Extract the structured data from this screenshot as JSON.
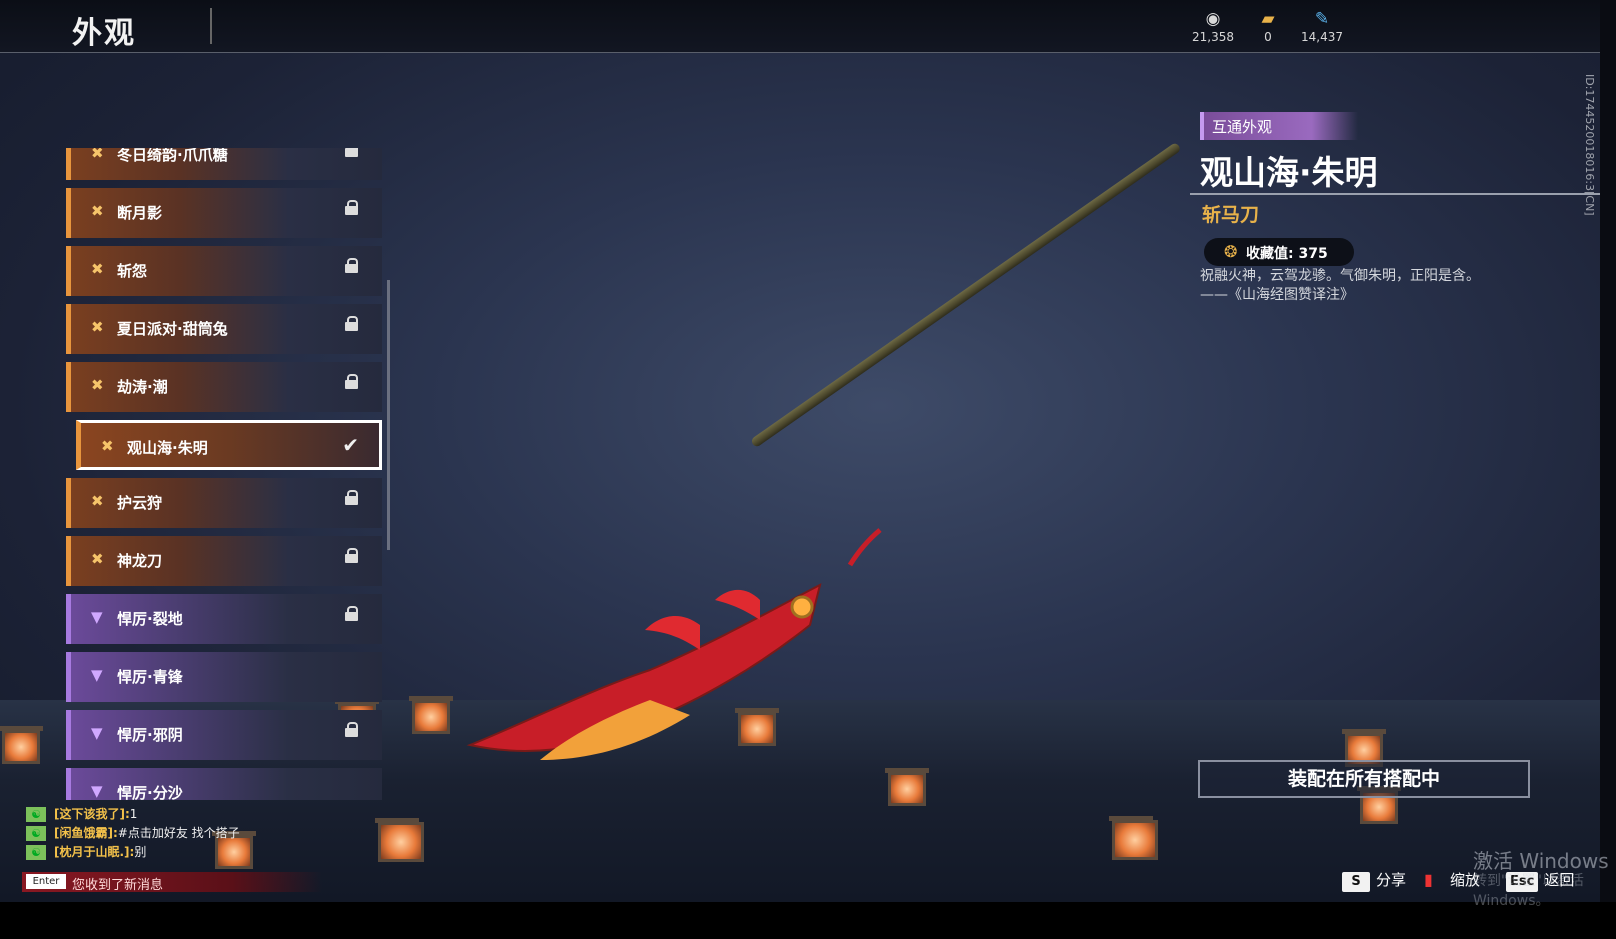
{
  "header": {
    "title": "外观"
  },
  "currencies": [
    {
      "icon": "coin-stack-icon",
      "value": "21,358"
    },
    {
      "icon": "ticket-icon",
      "value": "0"
    },
    {
      "icon": "feather-icon",
      "value": "14,437"
    }
  ],
  "side_id": "ID:1744520018016:3[CN]",
  "skins": [
    {
      "name": "冬日绮韵·爪爪糖",
      "rarity": "orange",
      "locked": true
    },
    {
      "name": "断月影",
      "rarity": "orange",
      "locked": true
    },
    {
      "name": "斩怨",
      "rarity": "orange",
      "locked": true
    },
    {
      "name": "夏日派对·甜筒兔",
      "rarity": "orange",
      "locked": true
    },
    {
      "name": "劫涛·潮",
      "rarity": "orange",
      "locked": true
    },
    {
      "name": "观山海·朱明",
      "rarity": "orange",
      "locked": false,
      "selected": true
    },
    {
      "name": "护云狩",
      "rarity": "orange",
      "locked": true
    },
    {
      "name": "神龙刀",
      "rarity": "orange",
      "locked": true
    },
    {
      "name": "悍厉·裂地",
      "rarity": "purple",
      "locked": true
    },
    {
      "name": "悍厉·青锋",
      "rarity": "purple",
      "locked": false
    },
    {
      "name": "悍厉·邪阴",
      "rarity": "purple",
      "locked": true
    },
    {
      "name": "悍厉·分沙",
      "rarity": "purple",
      "locked": false
    }
  ],
  "detail": {
    "tag": "互通外观",
    "name": "观山海·朱明",
    "type": "斩马刀",
    "collect_label": "收藏值: 375",
    "desc_line1": "祝融火神，云驾龙骖。气御朱明，正阳是含。",
    "desc_line2": "——《山海经图赞译注》",
    "equip_label": "装配在所有搭配中"
  },
  "chat": [
    {
      "user": "[这下该我了]:",
      "msg": "1"
    },
    {
      "user": "[闲鱼饿霸]:",
      "msg": "#点击加好友 找个搭子"
    },
    {
      "user": "[枕月于山眠.]:",
      "msg": "别"
    }
  ],
  "new_message": {
    "key": "Enter",
    "text": "您收到了新消息"
  },
  "keys": [
    {
      "key": "S",
      "label": "分享"
    },
    {
      "key": "",
      "label": "缩放"
    },
    {
      "key": "Esc",
      "label": "返回"
    }
  ],
  "watermark": {
    "line1": "激活 Windows",
    "line2": "转到\"设置\"以激活 Windows。"
  },
  "colors": {
    "orange_rarity": "#e8953d",
    "purple_rarity": "#a77ae0",
    "gold_text": "#e8b24a"
  }
}
